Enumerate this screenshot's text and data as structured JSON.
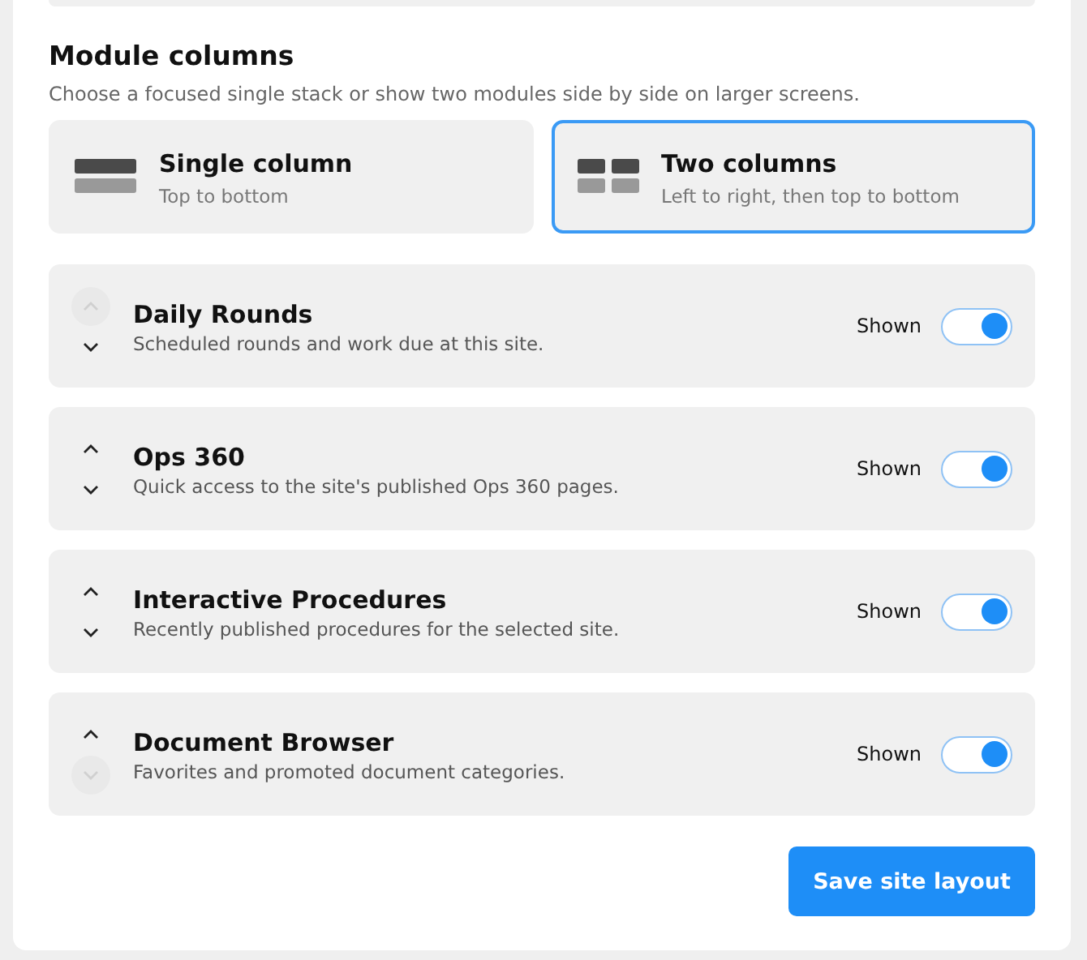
{
  "section": {
    "title": "Module columns",
    "description": "Choose a focused single stack or show two modules side by side on larger screens."
  },
  "layout_options": [
    {
      "kind": "single",
      "title": "Single column",
      "subtitle": "Top to bottom",
      "selected": false
    },
    {
      "kind": "double",
      "title": "Two columns",
      "subtitle": "Left to right, then top to bottom",
      "selected": true
    }
  ],
  "modules": [
    {
      "title": "Daily Rounds",
      "description": "Scheduled rounds and work due at this site.",
      "status": "Shown",
      "on": true,
      "up_disabled": true,
      "down_disabled": false
    },
    {
      "title": "Ops 360",
      "description": "Quick access to the site's published Ops 360 pages.",
      "status": "Shown",
      "on": true,
      "up_disabled": false,
      "down_disabled": false
    },
    {
      "title": "Interactive Procedures",
      "description": "Recently published procedures for the selected site.",
      "status": "Shown",
      "on": true,
      "up_disabled": false,
      "down_disabled": false
    },
    {
      "title": "Document Browser",
      "description": "Favorites and promoted document categories.",
      "status": "Shown",
      "on": true,
      "up_disabled": false,
      "down_disabled": true
    }
  ],
  "save_button": "Save site layout"
}
